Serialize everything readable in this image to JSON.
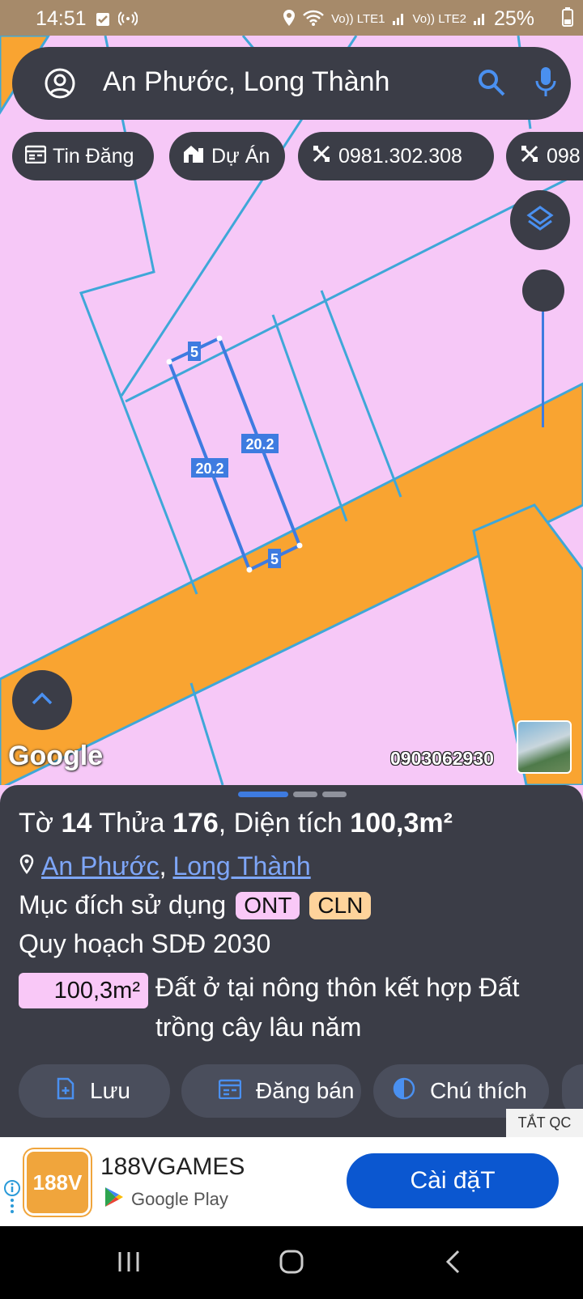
{
  "status_bar": {
    "time": "14:51",
    "battery": "25%",
    "signal_1": "Vo)) LTE1",
    "signal_2": "Vo)) LTE2"
  },
  "search": {
    "query": "An Phước, Long Thành"
  },
  "chips": [
    {
      "label": "Tin Đăng",
      "icon": "calendar-icon"
    },
    {
      "label": "Dự Án",
      "icon": "building-icon"
    },
    {
      "label": "0981.302.308",
      "icon": "tool-icon"
    },
    {
      "label": "098",
      "icon": "tool-icon"
    }
  ],
  "map": {
    "google_logo": "Google",
    "watermark": "0903062930",
    "dimension_labels": [
      "5",
      "20.2",
      "20.2",
      "5"
    ]
  },
  "details": {
    "title": {
      "sheet_label": "Tờ",
      "sheet_no": "14",
      "parcel_label": "Thửa",
      "parcel_no": "176",
      "area_label": "Diện tích",
      "area": "100,3m²"
    },
    "location": {
      "ward": "An Phước",
      "district": "Long Thành"
    },
    "purpose_label": "Mục đích sử dụng",
    "purpose_codes": [
      "ONT",
      "CLN"
    ],
    "plan_label": "Quy hoạch SDĐ 2030",
    "plan_area": "100,3m²",
    "plan_desc": "Đất ở tại nông thôn kết hợp Đất trồng cây lâu năm"
  },
  "actions": [
    {
      "label": "Lưu",
      "icon": "save-icon"
    },
    {
      "label": "Đăng bán",
      "icon": "calendar-icon"
    },
    {
      "label": "Chú thích",
      "icon": "contrast-icon"
    }
  ],
  "ad": {
    "close_label": "TẮT QC",
    "logo_text": "188V",
    "title": "188VGAMES",
    "store": "Google Play",
    "install_label": "Cài đặT"
  },
  "colors": {
    "parcel_fill": "#f6c8f7",
    "road": "#f9a431",
    "boundary": "#3fa7d8",
    "highlight": "#3e7be0",
    "panel": "#3b3d47",
    "install_button": "#0b57d0"
  }
}
